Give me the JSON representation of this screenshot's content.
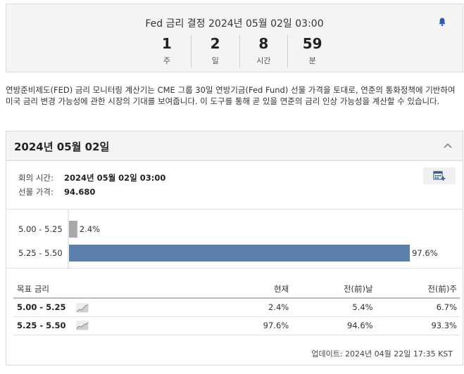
{
  "countdown": {
    "title": "Fed 금리 결정 2024년 05월 02일 03:00",
    "units": [
      {
        "value": "1",
        "label": "주"
      },
      {
        "value": "2",
        "label": "일"
      },
      {
        "value": "8",
        "label": "시간"
      },
      {
        "value": "59",
        "label": "분"
      }
    ]
  },
  "description": "연방준비제도(FED) 금리 모니터링 계산기는 CME 그룹 30일 연방기금(Fed Fund) 선물 가격을 토대로, 연준의 통화정책에 기반하여 미국 금리 변경 가능성에 관한 시장의 기대를 보여줍니다. 이 도구를 통해 곧 있을 연준의 금리 인상 가능성을 계산할 수 있습니다.",
  "panel": {
    "title": "2024년 05월 02일",
    "meeting_time_label": "회의 시간:",
    "meeting_time_value": "2024년 05월 02일 03:00",
    "futures_price_label": "선물 가격:",
    "futures_price_value": "94.680"
  },
  "chart_data": {
    "type": "bar",
    "orientation": "horizontal",
    "categories": [
      "5.00 - 5.25",
      "5.25 - 5.50"
    ],
    "values": [
      2.4,
      97.6
    ],
    "value_labels": [
      "2.4%",
      "97.6%"
    ],
    "colors": [
      "#a9a9a9",
      "#5b80ab"
    ],
    "xlim": [
      0,
      100
    ]
  },
  "table": {
    "headers": [
      "목표 금리",
      "현재",
      "전(前)날",
      "전(前)주"
    ],
    "rows": [
      {
        "range": "5.00 - 5.25",
        "current": "2.4%",
        "prev_day": "5.4%",
        "prev_week": "6.7%"
      },
      {
        "range": "5.25 - 5.50",
        "current": "97.6%",
        "prev_day": "94.6%",
        "prev_week": "93.3%"
      }
    ]
  },
  "updated": "업데이트: 2024년 04월 22일 17:35 KST",
  "colors": {
    "bar_primary": "#5b80ab",
    "bar_secondary": "#a9a9a9",
    "bell": "#2a5db0"
  },
  "icons": {
    "bell": "bell-icon",
    "collapse": "chevron-up-icon",
    "calendar": "calendar-add-icon",
    "sparkline": "sparkline-icon"
  }
}
